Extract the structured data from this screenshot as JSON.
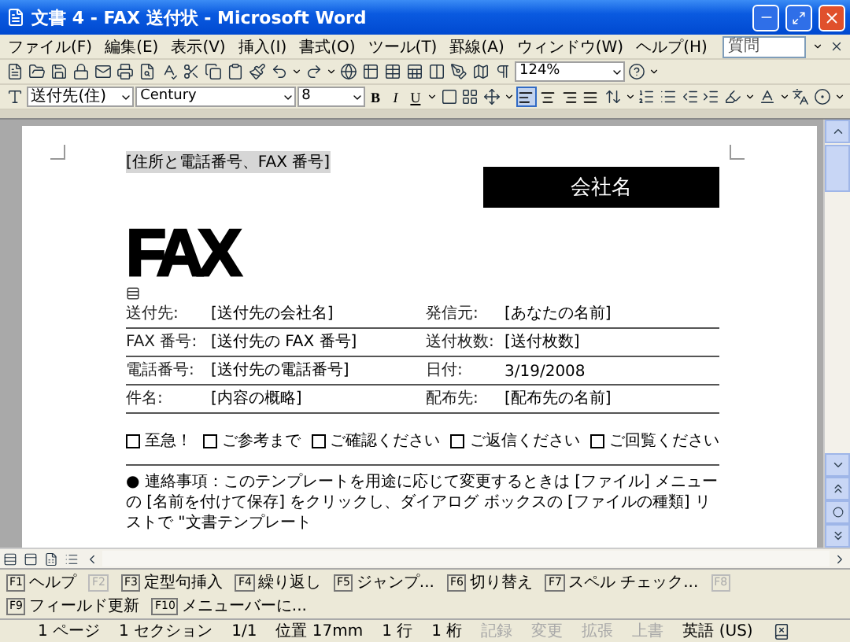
{
  "window": {
    "title": "文書 4 - FAX 送付状 - Microsoft Word"
  },
  "menu": [
    {
      "label": "ファイル(F)"
    },
    {
      "label": "編集(E)"
    },
    {
      "label": "表示(V)"
    },
    {
      "label": "挿入(I)"
    },
    {
      "label": "書式(O)"
    },
    {
      "label": "ツール(T)"
    },
    {
      "label": "罫線(A)"
    },
    {
      "label": "ウィンドウ(W)"
    },
    {
      "label": "ヘルプ(H)"
    }
  ],
  "help_box": {
    "placeholder": "質問"
  },
  "toolbar": {
    "zoom": "124%",
    "style": "送付先(住)",
    "font": "Century",
    "size": "8",
    "text_buttons": [
      "B",
      "I",
      "U"
    ],
    "alignment": [
      {
        "kind": "left",
        "selected": true
      },
      {
        "kind": "center",
        "selected": false
      },
      {
        "kind": "right",
        "selected": false
      },
      {
        "kind": "distribute",
        "selected": false
      }
    ]
  },
  "document": {
    "address": "[住所と電話番号、FAX 番号]",
    "company": "会社名",
    "logo": "FAX",
    "fields": [
      {
        "label": "送付先:",
        "value": "[送付先の会社名]",
        "label_2": "発信元:",
        "value_2": "[あなたの名前]"
      },
      {
        "label": "FAX 番号:",
        "value": "[送付先の FAX 番号]",
        "label_2": "送付枚数:",
        "value_2": "[送付枚数]"
      },
      {
        "label": "電話番号:",
        "value": "[送付先の電話番号]",
        "label_2": "日付:",
        "value_2": "3/19/2008"
      },
      {
        "label": "件名:",
        "value": "[内容の概略]",
        "label_2": "配布先:",
        "value_2": "[配布先の名前]"
      }
    ],
    "options": [
      {
        "label": "至急！",
        "checked": false
      },
      {
        "label": "ご参考まで",
        "checked": false
      },
      {
        "label": "ご確認ください",
        "checked": false
      },
      {
        "label": "ご返信ください",
        "checked": false
      },
      {
        "label": "ご回覧ください",
        "checked": false
      }
    ],
    "note": "● 連絡事項：このテンプレートを用途に応じて変更するときは [ファイル] メニューの [名前を付けて保存] をクリックし、ダイアログ ボックスの [ファイルの種類] リストで \"文書テンプレート"
  },
  "function_keys": [
    {
      "key": "F1",
      "label": "ヘルプ",
      "disabled": false
    },
    {
      "key": "F2",
      "disabled": true
    },
    {
      "key": "F3",
      "label": "定型句挿入",
      "disabled": false
    },
    {
      "key": "F4",
      "label": "繰り返し",
      "disabled": false
    },
    {
      "key": "F5",
      "label": "ジャンプ...",
      "disabled": false
    },
    {
      "key": "F6",
      "label": "切り替え",
      "disabled": false
    },
    {
      "key": "F7",
      "label": "スペル チェック...",
      "disabled": false
    },
    {
      "key": "F8",
      "disabled": true
    },
    {
      "key": "F9",
      "label": "フィールド更新",
      "disabled": false
    },
    {
      "key": "F10",
      "label": "メニューバーに...",
      "disabled": false
    }
  ],
  "status_bar": [
    {
      "text": "1 ページ",
      "disabled": false
    },
    {
      "text": "1 セクション",
      "disabled": false
    },
    {
      "text": "1/1",
      "disabled": false
    },
    {
      "text": "位置 17mm",
      "disabled": false
    },
    {
      "text": "1 行",
      "disabled": false
    },
    {
      "text": "1 桁",
      "disabled": false
    },
    {
      "text": "記録",
      "disabled": true
    },
    {
      "text": "変更",
      "disabled": true
    },
    {
      "text": "拡張",
      "disabled": true
    },
    {
      "text": "上書",
      "disabled": true
    },
    {
      "text": "英語 (US)",
      "disabled": false
    }
  ]
}
